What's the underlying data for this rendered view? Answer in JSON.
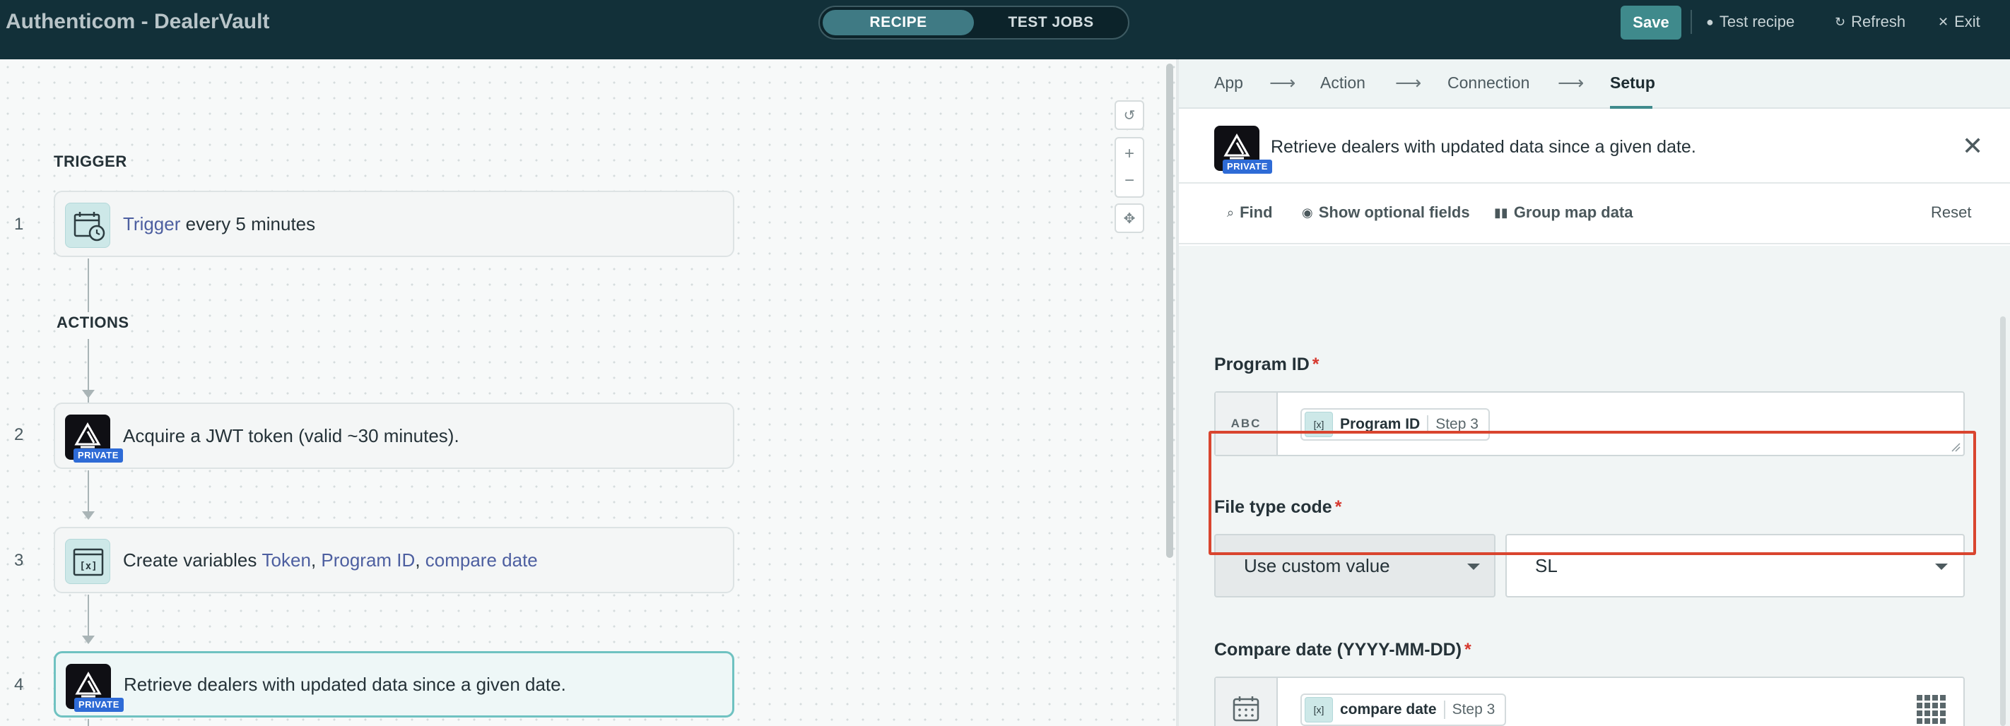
{
  "topbar": {
    "title": "Authenticom - DealerVault",
    "tabs": [
      "RECIPE",
      "TEST JOBS"
    ],
    "save_label": "Save",
    "test_recipe_label": "Test recipe",
    "refresh_label": "Refresh",
    "exit_label": "Exit"
  },
  "canvas": {
    "trigger_label": "TRIGGER",
    "actions_label": "ACTIONS",
    "steps": [
      {
        "num": "1",
        "prefix": "",
        "link": "Trigger",
        "text": " every 5 minutes"
      },
      {
        "num": "2",
        "text": "Acquire a JWT token (valid ~30 minutes).",
        "badge": "PRIVATE"
      },
      {
        "num": "3",
        "text": "Create variables ",
        "var1": "Token",
        "sep1": ", ",
        "var2": "Program ID",
        "sep2": ", ",
        "var3": "compare date"
      },
      {
        "num": "4",
        "text": "Retrieve dealers with updated data since a given date.",
        "badge": "PRIVATE"
      }
    ]
  },
  "panel": {
    "wizard": [
      "App",
      "Action",
      "Connection",
      "Setup"
    ],
    "wizard_active": "Setup",
    "action_title": "Retrieve dealers with updated data since a given date.",
    "badge": "PRIVATE",
    "toolbar": {
      "find": "Find",
      "optional": "Show optional fields",
      "group": "Group map data",
      "reset": "Reset"
    },
    "fields": {
      "program_id": {
        "label": "Program ID",
        "prefix": "ABC",
        "pill_name": "Program ID",
        "pill_step": "Step 3"
      },
      "file_type": {
        "label": "File type code",
        "mode": "Use custom value",
        "value": "SL"
      },
      "compare_date": {
        "label": "Compare date (YYYY-MM-DD)",
        "pill_name": "compare date",
        "pill_step": "Step 3"
      }
    }
  },
  "colors": {
    "topbar": "#123039",
    "accent": "#3f8a8c",
    "private_badge": "#2e6bd6",
    "highlight": "#d9452f",
    "required": "#d6382e"
  }
}
